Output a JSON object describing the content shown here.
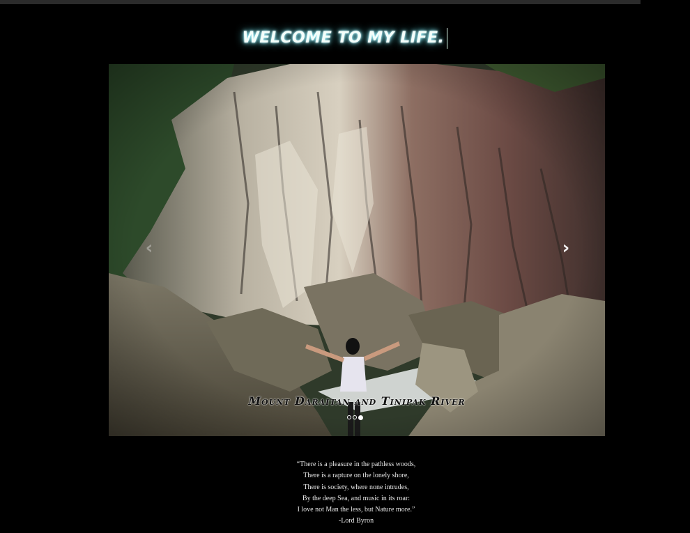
{
  "page": {
    "title": "WELCOME TO MY LIFE."
  },
  "carousel": {
    "caption": "Mount Daraitan and Tinipak River",
    "prev_icon": "chevron-left-icon",
    "next_icon": "chevron-right-icon",
    "prev_glyph": "‹",
    "next_glyph": "›",
    "slide_count": 3,
    "active_slide": 3
  },
  "quote": {
    "lines": [
      "“There is a pleasure in the pathless woods,",
      "There is a rapture on the lonely shore,",
      "There is society, where none intrudes,",
      "By the deep Sea, and music in its roar:",
      "I love not Man the less, but Nature more.”"
    ],
    "attribution": "-Lord Byron"
  },
  "colors": {
    "background": "#000000",
    "title_glow": "#5fdfe8",
    "top_bar": "#2b2b2b"
  }
}
